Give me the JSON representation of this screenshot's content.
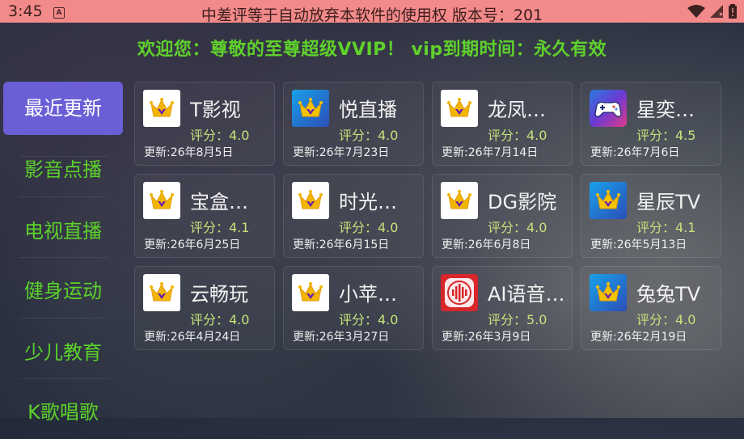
{
  "status_bar": {
    "time": "3:45",
    "title": "中差评等于自动放弃本软件的使用权 版本号：201",
    "icons": [
      "a-notification-icon",
      "wifi-icon",
      "signal-icon",
      "battery-icon"
    ]
  },
  "welcome": "欢迎您：尊敬的至尊超级VVIP！ vip到期时间：永久有效",
  "sidebar": {
    "items": [
      {
        "label": "最近更新",
        "active": true
      },
      {
        "label": "影音点播",
        "active": false
      },
      {
        "label": "电视直播",
        "active": false
      },
      {
        "label": "健身运动",
        "active": false
      },
      {
        "label": "少儿教育",
        "active": false
      },
      {
        "label": "K歌唱歌",
        "active": false
      }
    ]
  },
  "apps": [
    {
      "name": "T影视",
      "score": "评分：4.0",
      "date": "更新:26年8月5日",
      "icon": "crown-white"
    },
    {
      "name": "悦直播",
      "score": "评分：4.0",
      "date": "更新:26年7月23日",
      "icon": "crown-blue"
    },
    {
      "name": "龙凤…",
      "score": "评分：4.0",
      "date": "更新:26年7月14日",
      "icon": "crown-white"
    },
    {
      "name": "星奕…",
      "score": "评分：4.5",
      "date": "更新:26年7月6日",
      "icon": "gamepad"
    },
    {
      "name": "宝盒…",
      "score": "评分：4.1",
      "date": "更新:26年6月25日",
      "icon": "crown-white"
    },
    {
      "name": "时光…",
      "score": "评分：4.0",
      "date": "更新:26年6月15日",
      "icon": "crown-white"
    },
    {
      "name": "DG影院",
      "score": "评分：4.0",
      "date": "更新:26年6月8日",
      "icon": "crown-white"
    },
    {
      "name": "星辰TV",
      "score": "评分：4.1",
      "date": "更新:26年5月13日",
      "icon": "crown-blue"
    },
    {
      "name": "云畅玩",
      "score": "评分：4.0",
      "date": "更新:26年4月24日",
      "icon": "crown-white"
    },
    {
      "name": "小苹…",
      "score": "评分：4.0",
      "date": "更新:26年3月27日",
      "icon": "crown-white"
    },
    {
      "name": "AI语音…",
      "score": "评分：5.0",
      "date": "更新:26年3月9日",
      "icon": "ai-voice"
    },
    {
      "name": "兔兔TV",
      "score": "评分：4.0",
      "date": "更新:26年2月19日",
      "icon": "crown-blue"
    }
  ],
  "colors": {
    "status_bar_bg": "#f38a8a",
    "accent_green": "#5cd22a",
    "sidebar_active": "#6a5fd6",
    "score_color": "#c8e27a"
  }
}
